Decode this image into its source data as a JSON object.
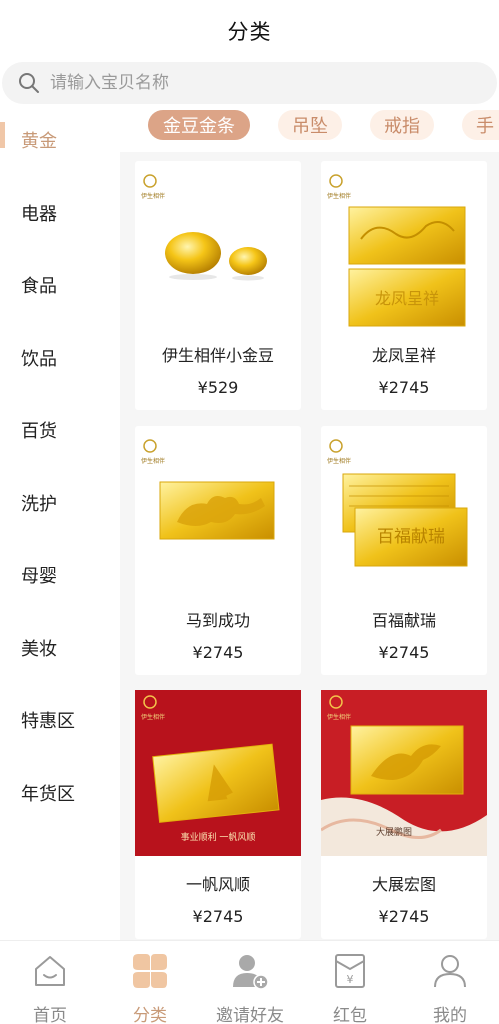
{
  "header": {
    "title": "分类"
  },
  "search": {
    "placeholder": "请输入宝贝名称",
    "icon": "search-icon"
  },
  "sidebar": {
    "items": [
      {
        "label": "黄金",
        "active": true
      },
      {
        "label": "电器"
      },
      {
        "label": "食品"
      },
      {
        "label": "饮品"
      },
      {
        "label": "百货"
      },
      {
        "label": "洗护"
      },
      {
        "label": "母婴"
      },
      {
        "label": "美妆"
      },
      {
        "label": "特惠区"
      },
      {
        "label": "年货区"
      }
    ]
  },
  "subtabs": [
    {
      "label": "金豆金条",
      "active": true
    },
    {
      "label": "吊坠"
    },
    {
      "label": "戒指"
    },
    {
      "label": "手"
    }
  ],
  "products": [
    {
      "name": "伊生相伴小金豆",
      "price": "¥529",
      "image": "gold-beans-image"
    },
    {
      "name": "龙凤呈祥",
      "price": "¥2745",
      "image": "dragon-phoenix-gold-bar-image"
    },
    {
      "name": "马到成功",
      "price": "¥2745",
      "image": "horse-gold-bar-image"
    },
    {
      "name": "百福献瑞",
      "price": "¥2745",
      "image": "baifu-gold-bar-image"
    },
    {
      "name": "一帆风顺",
      "price": "¥2745",
      "image": "sailing-gold-bar-image",
      "banner": "事业顺利 一帆风顺"
    },
    {
      "name": "大展宏图",
      "price": "¥2745",
      "image": "eagle-gold-bar-image",
      "banner": "大展鹏图"
    }
  ],
  "brand": {
    "logo_text": "伊生相伴"
  },
  "bottom_nav": [
    {
      "label": "首页",
      "icon": "home-icon"
    },
    {
      "label": "分类",
      "icon": "category-icon",
      "active": true
    },
    {
      "label": "邀请好友",
      "icon": "invite-friend-icon"
    },
    {
      "label": "红包",
      "icon": "red-packet-icon"
    },
    {
      "label": "我的",
      "icon": "profile-icon"
    }
  ],
  "colors": {
    "accent": "#c89a78",
    "tab_active": "#dca487",
    "tab_bg": "#fdf0e7",
    "gold": "#f2c61a",
    "red": "#c4141f"
  }
}
